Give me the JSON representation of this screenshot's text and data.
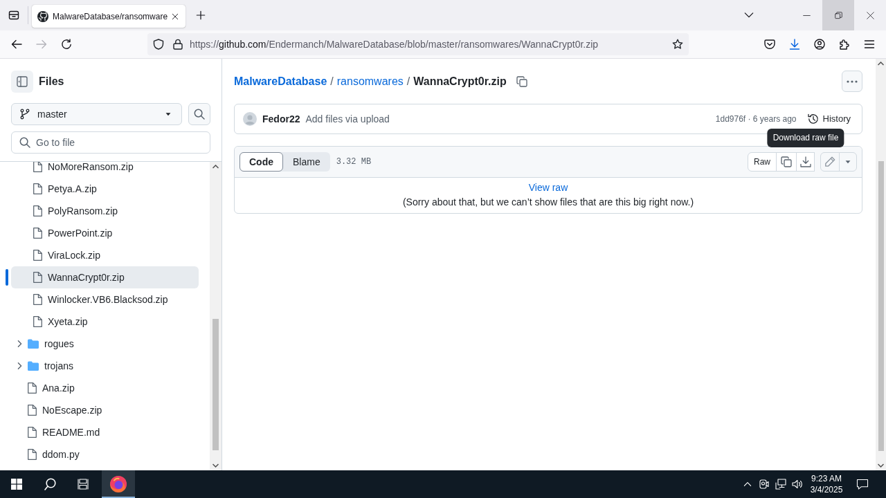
{
  "browser": {
    "tabs": [
      {
        "title": "MalwareDatabase/ransomware",
        "selected": true
      }
    ],
    "window_buttons": [
      {
        "kind": "minimize",
        "hovered": false
      },
      {
        "kind": "restore",
        "hovered": true
      },
      {
        "kind": "close",
        "hovered": false
      }
    ],
    "nav_buttons": [
      {
        "kind": "back",
        "disabled": false
      },
      {
        "kind": "forward",
        "disabled": true
      },
      {
        "kind": "reload",
        "disabled": false
      }
    ],
    "url": {
      "scheme": "https://",
      "host": "github.com",
      "path": "/Endermanch/MalwareDatabase/blob/master/ransomwares/WannaCrypt0r.zip"
    },
    "toolbar": [
      {
        "kind": "pocket",
        "active": false
      },
      {
        "kind": "downloads",
        "active": true
      },
      {
        "kind": "account",
        "active": false
      },
      {
        "kind": "extensions",
        "active": false
      },
      {
        "kind": "menu",
        "active": false
      }
    ]
  },
  "sidebar": {
    "title": "Files",
    "branch": "master",
    "file_filter": {
      "placeholder": "Go to file"
    },
    "tree": [
      {
        "kind": "continued",
        "children": [
          {
            "kind": "file",
            "name": "NoMoreRansom.zip",
            "selected": false
          },
          {
            "kind": "file",
            "name": "Petya.A.zip",
            "selected": false
          },
          {
            "kind": "file",
            "name": "PolyRansom.zip",
            "selected": false
          },
          {
            "kind": "file",
            "name": "PowerPoint.zip",
            "selected": false
          },
          {
            "kind": "file",
            "name": "ViraLock.zip",
            "selected": false
          },
          {
            "kind": "file",
            "name": "WannaCrypt0r.zip",
            "selected": true
          },
          {
            "kind": "file",
            "name": "Winlocker.VB6.Blacksod.zip",
            "selected": false
          },
          {
            "kind": "file",
            "name": "Xyeta.zip",
            "selected": false
          }
        ]
      },
      {
        "kind": "folder",
        "name": "rogues",
        "expanded": false,
        "selected": false
      },
      {
        "kind": "folder",
        "name": "trojans",
        "expanded": false,
        "selected": false
      },
      {
        "kind": "file",
        "name": "Ana.zip",
        "selected": false
      },
      {
        "kind": "file",
        "name": "NoEscape.zip",
        "selected": false
      },
      {
        "kind": "file",
        "name": "README.md",
        "selected": false
      },
      {
        "kind": "file",
        "name": "ddom.py",
        "selected": false
      }
    ]
  },
  "breadcrumb": [
    {
      "kind": "link",
      "text": "MalwareDatabase"
    },
    {
      "kind": "separator",
      "text": "/"
    },
    {
      "kind": "link",
      "text": "ransomwares"
    },
    {
      "kind": "separator",
      "text": "/"
    },
    {
      "kind": "current",
      "text": "WannaCrypt0r.zip"
    }
  ],
  "commit": {
    "author": "Fedor22",
    "message": "Add files via upload",
    "meta": "1dd976f · 6 years ago",
    "history": "History"
  },
  "file_view": {
    "view_tabs": [
      {
        "label": "Code",
        "selected": true
      },
      {
        "label": "Blame",
        "selected": false
      }
    ],
    "size": "3.32 MB",
    "raw": "Raw",
    "tooltip": "Download raw file",
    "edit_disabled": true,
    "view_raw": "View raw",
    "notice": "(Sorry about that, but we can’t show files that are this big right now.)"
  },
  "taskbar": {
    "apps": [
      {
        "kind": "browser",
        "running": true
      }
    ],
    "time": "9:23 AM",
    "date": "3/4/2025"
  }
}
